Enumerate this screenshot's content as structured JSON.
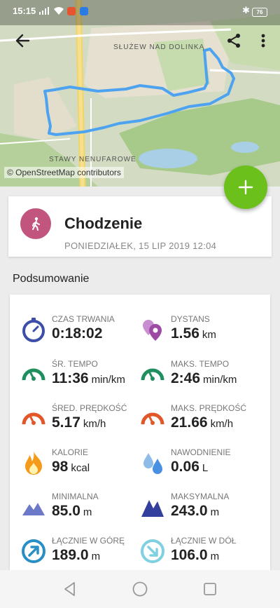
{
  "status_bar": {
    "time": "15:15",
    "battery": "76"
  },
  "map": {
    "labels": {
      "district": "SŁUŻEW NAD DOLINKĄ",
      "park": "STAWY NENUFAROWE"
    },
    "attribution": "© OpenStreetMap contributors"
  },
  "toolbar": {
    "back_icon": "arrow-left-icon",
    "share_icon": "share-icon",
    "more_icon": "more-vert-icon"
  },
  "fab": {
    "icon": "plus-icon"
  },
  "activity": {
    "icon": "walking-icon",
    "title": "Chodzenie",
    "date": "PONIEDZIAŁEK, 15 LIP 2019 12:04"
  },
  "summary": {
    "title": "Podsumowanie",
    "stats": [
      {
        "icon": "stopwatch-icon",
        "label": "CZAS TRWANIA",
        "value": "0:18:02",
        "unit": ""
      },
      {
        "icon": "location-pins-icon",
        "label": "DYSTANS",
        "value": "1.56",
        "unit": "km"
      },
      {
        "icon": "speedometer-green-icon",
        "label": "ŚR. TEMPO",
        "value": "11:36",
        "unit": "min/km"
      },
      {
        "icon": "speedometer-green-icon",
        "label": "MAKS. TEMPO",
        "value": "2:46",
        "unit": "min/km"
      },
      {
        "icon": "speedometer-orange-icon",
        "label": "ŚRED. PRĘDKOŚĆ",
        "value": "5.17",
        "unit": "km/h"
      },
      {
        "icon": "speedometer-orange-icon",
        "label": "MAKS. PRĘDKOŚĆ",
        "value": "21.66",
        "unit": "km/h"
      },
      {
        "icon": "flame-icon",
        "label": "KALORIE",
        "value": "98",
        "unit": "kcal"
      },
      {
        "icon": "water-drops-icon",
        "label": "NAWODNIENIE",
        "value": "0.06",
        "unit": "L"
      },
      {
        "icon": "mountain-light-icon",
        "label": "MINIMALNA",
        "value": "85.0",
        "unit": "m"
      },
      {
        "icon": "mountain-dark-icon",
        "label": "MAKSYMALNA",
        "value": "243.0",
        "unit": "m"
      },
      {
        "icon": "arrow-up-right-circle-icon",
        "label": "ŁĄCZNIE W GÓRĘ",
        "value": "189.0",
        "unit": "m"
      },
      {
        "icon": "arrow-down-right-circle-icon",
        "label": "ŁĄCZNIE W DÓŁ",
        "value": "106.0",
        "unit": "m"
      }
    ]
  },
  "colors": {
    "fab": "#6cc01b",
    "activity_icon_bg": "#c2557e",
    "route": "#4ea3f0",
    "stopwatch": "#3b4fa8",
    "pins": "#9c4aa4",
    "speed_green": "#1f8f5f",
    "speed_orange": "#e2572a",
    "flame": "#f59a1a",
    "water": "#4a90e2",
    "mountain_light": "#6c79c9",
    "mountain_dark": "#333f9c",
    "arrow_up": "#2a8fc4",
    "arrow_down": "#7fd0e0"
  }
}
